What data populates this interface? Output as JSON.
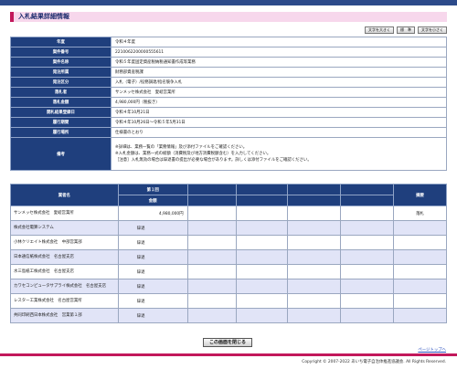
{
  "header": {
    "title": "入札結果詳細情報"
  },
  "font_buttons": [
    "文字を大きく",
    "標　準",
    "文字を小さく"
  ],
  "detail_rows": [
    {
      "label": "年度",
      "value": "令和４年度"
    },
    {
      "label": "案件番号",
      "value": "2210062200000555611"
    },
    {
      "label": "案件名称",
      "value": "令和５年度固定資産税納税通知書作成等業務"
    },
    {
      "label": "発注所属",
      "value": "財務部資産税課"
    },
    {
      "label": "発注区分",
      "value": "入札（電子）/役務調達/指名競争入札"
    },
    {
      "label": "落札者",
      "value": "サンメッセ株式会社　愛岐営業所"
    },
    {
      "label": "落札金額",
      "value": "4,980,000円（税抜き）"
    },
    {
      "label": "開札結果登録日",
      "value": "令和４年10月21日"
    },
    {
      "label": "履行期間",
      "value": "令和４年10月26日～令和５年5月31日"
    },
    {
      "label": "履行場所",
      "value": "仕様書のとおり"
    }
  ],
  "notes": {
    "label": "備考",
    "lines": [
      "※詳細は、業務一覧の「業務情報」及び添付ファイルをご確認ください。",
      "※入札金額は、業務一式の総額（消費税及び地方消費税額含む）を入力してください。",
      "［注意］入札無効の場合は辞退書の提出が必要な場合があります。詳しくは添付ファイルをご確認ください。"
    ]
  },
  "results": {
    "headers": {
      "bidder": "業者名",
      "round": "第１回",
      "amount": "金額",
      "remarks": "摘要"
    },
    "rows": [
      {
        "name": "サンメッセ株式会社　愛岐営業所",
        "amount": "4,980,000円",
        "status": "",
        "remarks": "落札"
      },
      {
        "name": "株式会社電算システム",
        "amount": "",
        "status": "辞退",
        "remarks": ""
      },
      {
        "name": "小林クリエイト株式会社　中部営業部",
        "amount": "",
        "status": "辞退",
        "remarks": ""
      },
      {
        "name": "日本通信紙株式会社　名古屋支店",
        "amount": "",
        "status": "辞退",
        "remarks": ""
      },
      {
        "name": "水三島紙工株式会社　名古屋支店",
        "amount": "",
        "status": "辞退",
        "remarks": ""
      },
      {
        "name": "カワセコンピュータサプライ株式会社　名古屋支店",
        "amount": "",
        "status": "辞退",
        "remarks": ""
      },
      {
        "name": "レスター工業株式会社　名古屋営業所",
        "amount": "",
        "status": "辞退",
        "remarks": ""
      },
      {
        "name": "共同印刷西日本株式会社　営業第１部",
        "amount": "",
        "status": "辞退",
        "remarks": ""
      }
    ]
  },
  "close_button": "この画面を閉じる",
  "top_link": "ページトップへ",
  "copyright": "Copyright © 2007-2022 あいち電子自治体推進協議会. All Rights Reserved.",
  "colors": {
    "header_bg": "#1f3f7d",
    "title_accent": "#c2185b",
    "alt_row": "#e1e4f7"
  }
}
